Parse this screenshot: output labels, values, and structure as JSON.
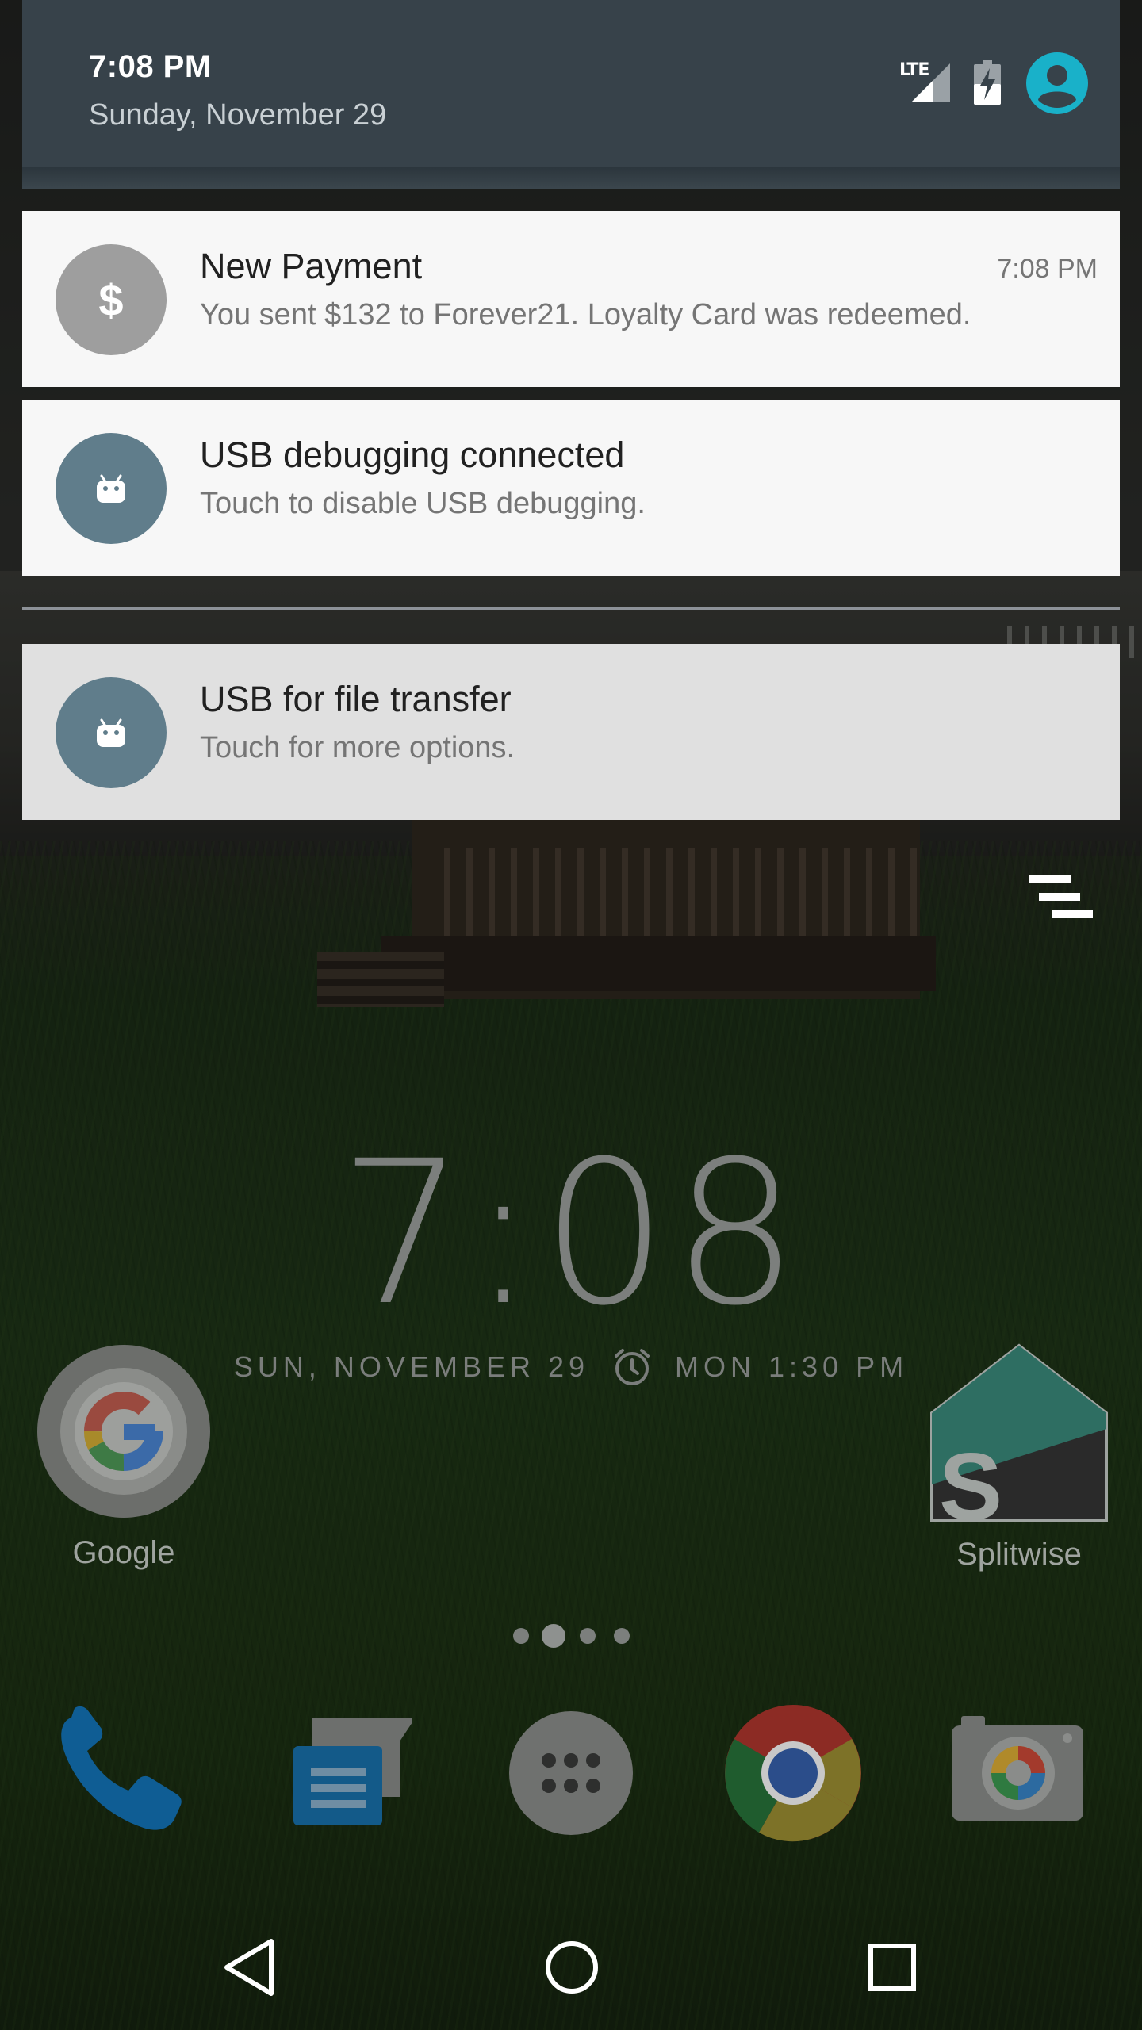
{
  "shade_header": {
    "time": "7:08 PM",
    "date": "Sunday, November 29",
    "network_label": "LTE",
    "icons": [
      "signal-icon",
      "battery-charging-icon",
      "user-avatar-icon"
    ],
    "avatar_color": "#19b1c9"
  },
  "notifications": [
    {
      "title": "New Payment",
      "body": "You sent $132 to Forever21. Loyalty Card was redeemed.",
      "time": "7:08 PM",
      "icon": "dollar-icon",
      "icon_symbol": "$",
      "icon_color": "#9e9e9e"
    },
    {
      "title": "USB debugging connected",
      "body": "Touch to disable USB debugging.",
      "icon": "android-icon",
      "icon_color": "#607d8b"
    },
    {
      "title": "USB for file transfer",
      "body": "Touch for more options.",
      "icon": "android-icon",
      "icon_color": "#607d8b"
    }
  ],
  "clock": {
    "time": "7:08",
    "date": "SUN, NOVEMBER 29",
    "alarm": "MON 1:30 PM"
  },
  "home_apps": [
    {
      "label": "Google",
      "icon": "google-icon"
    },
    {
      "label": "Splitwise",
      "icon": "splitwise-icon"
    }
  ],
  "page_indicator": {
    "pages": 4,
    "current": 2
  },
  "dock": [
    "phone-icon",
    "messages-icon",
    "app-drawer-icon",
    "chrome-icon",
    "camera-icon"
  ],
  "nav_bar": [
    "back-icon",
    "home-icon",
    "recents-icon"
  ]
}
